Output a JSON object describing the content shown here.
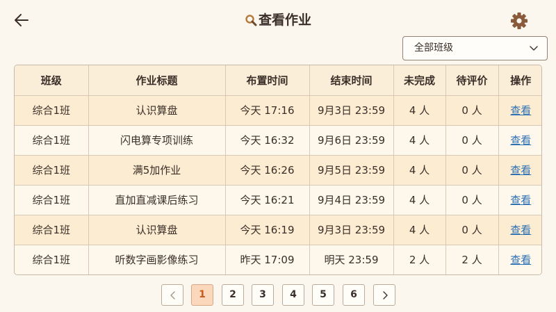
{
  "header": {
    "title": "查看作业",
    "back_icon": "arrow-left-icon",
    "search_icon": "search-icon",
    "settings_icon": "gear-icon"
  },
  "filter": {
    "selected": "全部班级"
  },
  "table": {
    "columns": [
      "班级",
      "作业标题",
      "布置时间",
      "结束时间",
      "未完成",
      "待评价",
      "操作"
    ],
    "rows": [
      {
        "class": "综合1班",
        "title": "认识算盘",
        "assigned": "今天 17:16",
        "end": "9月3日 23:59",
        "incomplete": "4 人",
        "pending": "0 人",
        "action": "查看"
      },
      {
        "class": "综合1班",
        "title": "闪电算专项训练",
        "assigned": "今天 16:32",
        "end": "9月6日 23:59",
        "incomplete": "4 人",
        "pending": "0 人",
        "action": "查看"
      },
      {
        "class": "综合1班",
        "title": "满5加作业",
        "assigned": "今天 16:26",
        "end": "9月5日 23:59",
        "incomplete": "4 人",
        "pending": "0 人",
        "action": "查看"
      },
      {
        "class": "综合1班",
        "title": "直加直减课后练习",
        "assigned": "今天 16:21",
        "end": "9月4日 23:59",
        "incomplete": "4 人",
        "pending": "0 人",
        "action": "查看"
      },
      {
        "class": "综合1班",
        "title": "认识算盘",
        "assigned": "今天 16:19",
        "end": "9月3日 23:59",
        "incomplete": "4 人",
        "pending": "0 人",
        "action": "查看"
      },
      {
        "class": "综合1班",
        "title": "听数字画影像练习",
        "assigned": "昨天 17:09",
        "end": "明天 23:59",
        "incomplete": "2 人",
        "pending": "2 人",
        "action": "查看"
      }
    ]
  },
  "pagination": {
    "pages": [
      "1",
      "2",
      "3",
      "4",
      "5",
      "6"
    ],
    "current": "1"
  },
  "colors": {
    "accent": "#c45a1e",
    "link": "#2d6fb3",
    "gear": "#8a5a3c"
  }
}
